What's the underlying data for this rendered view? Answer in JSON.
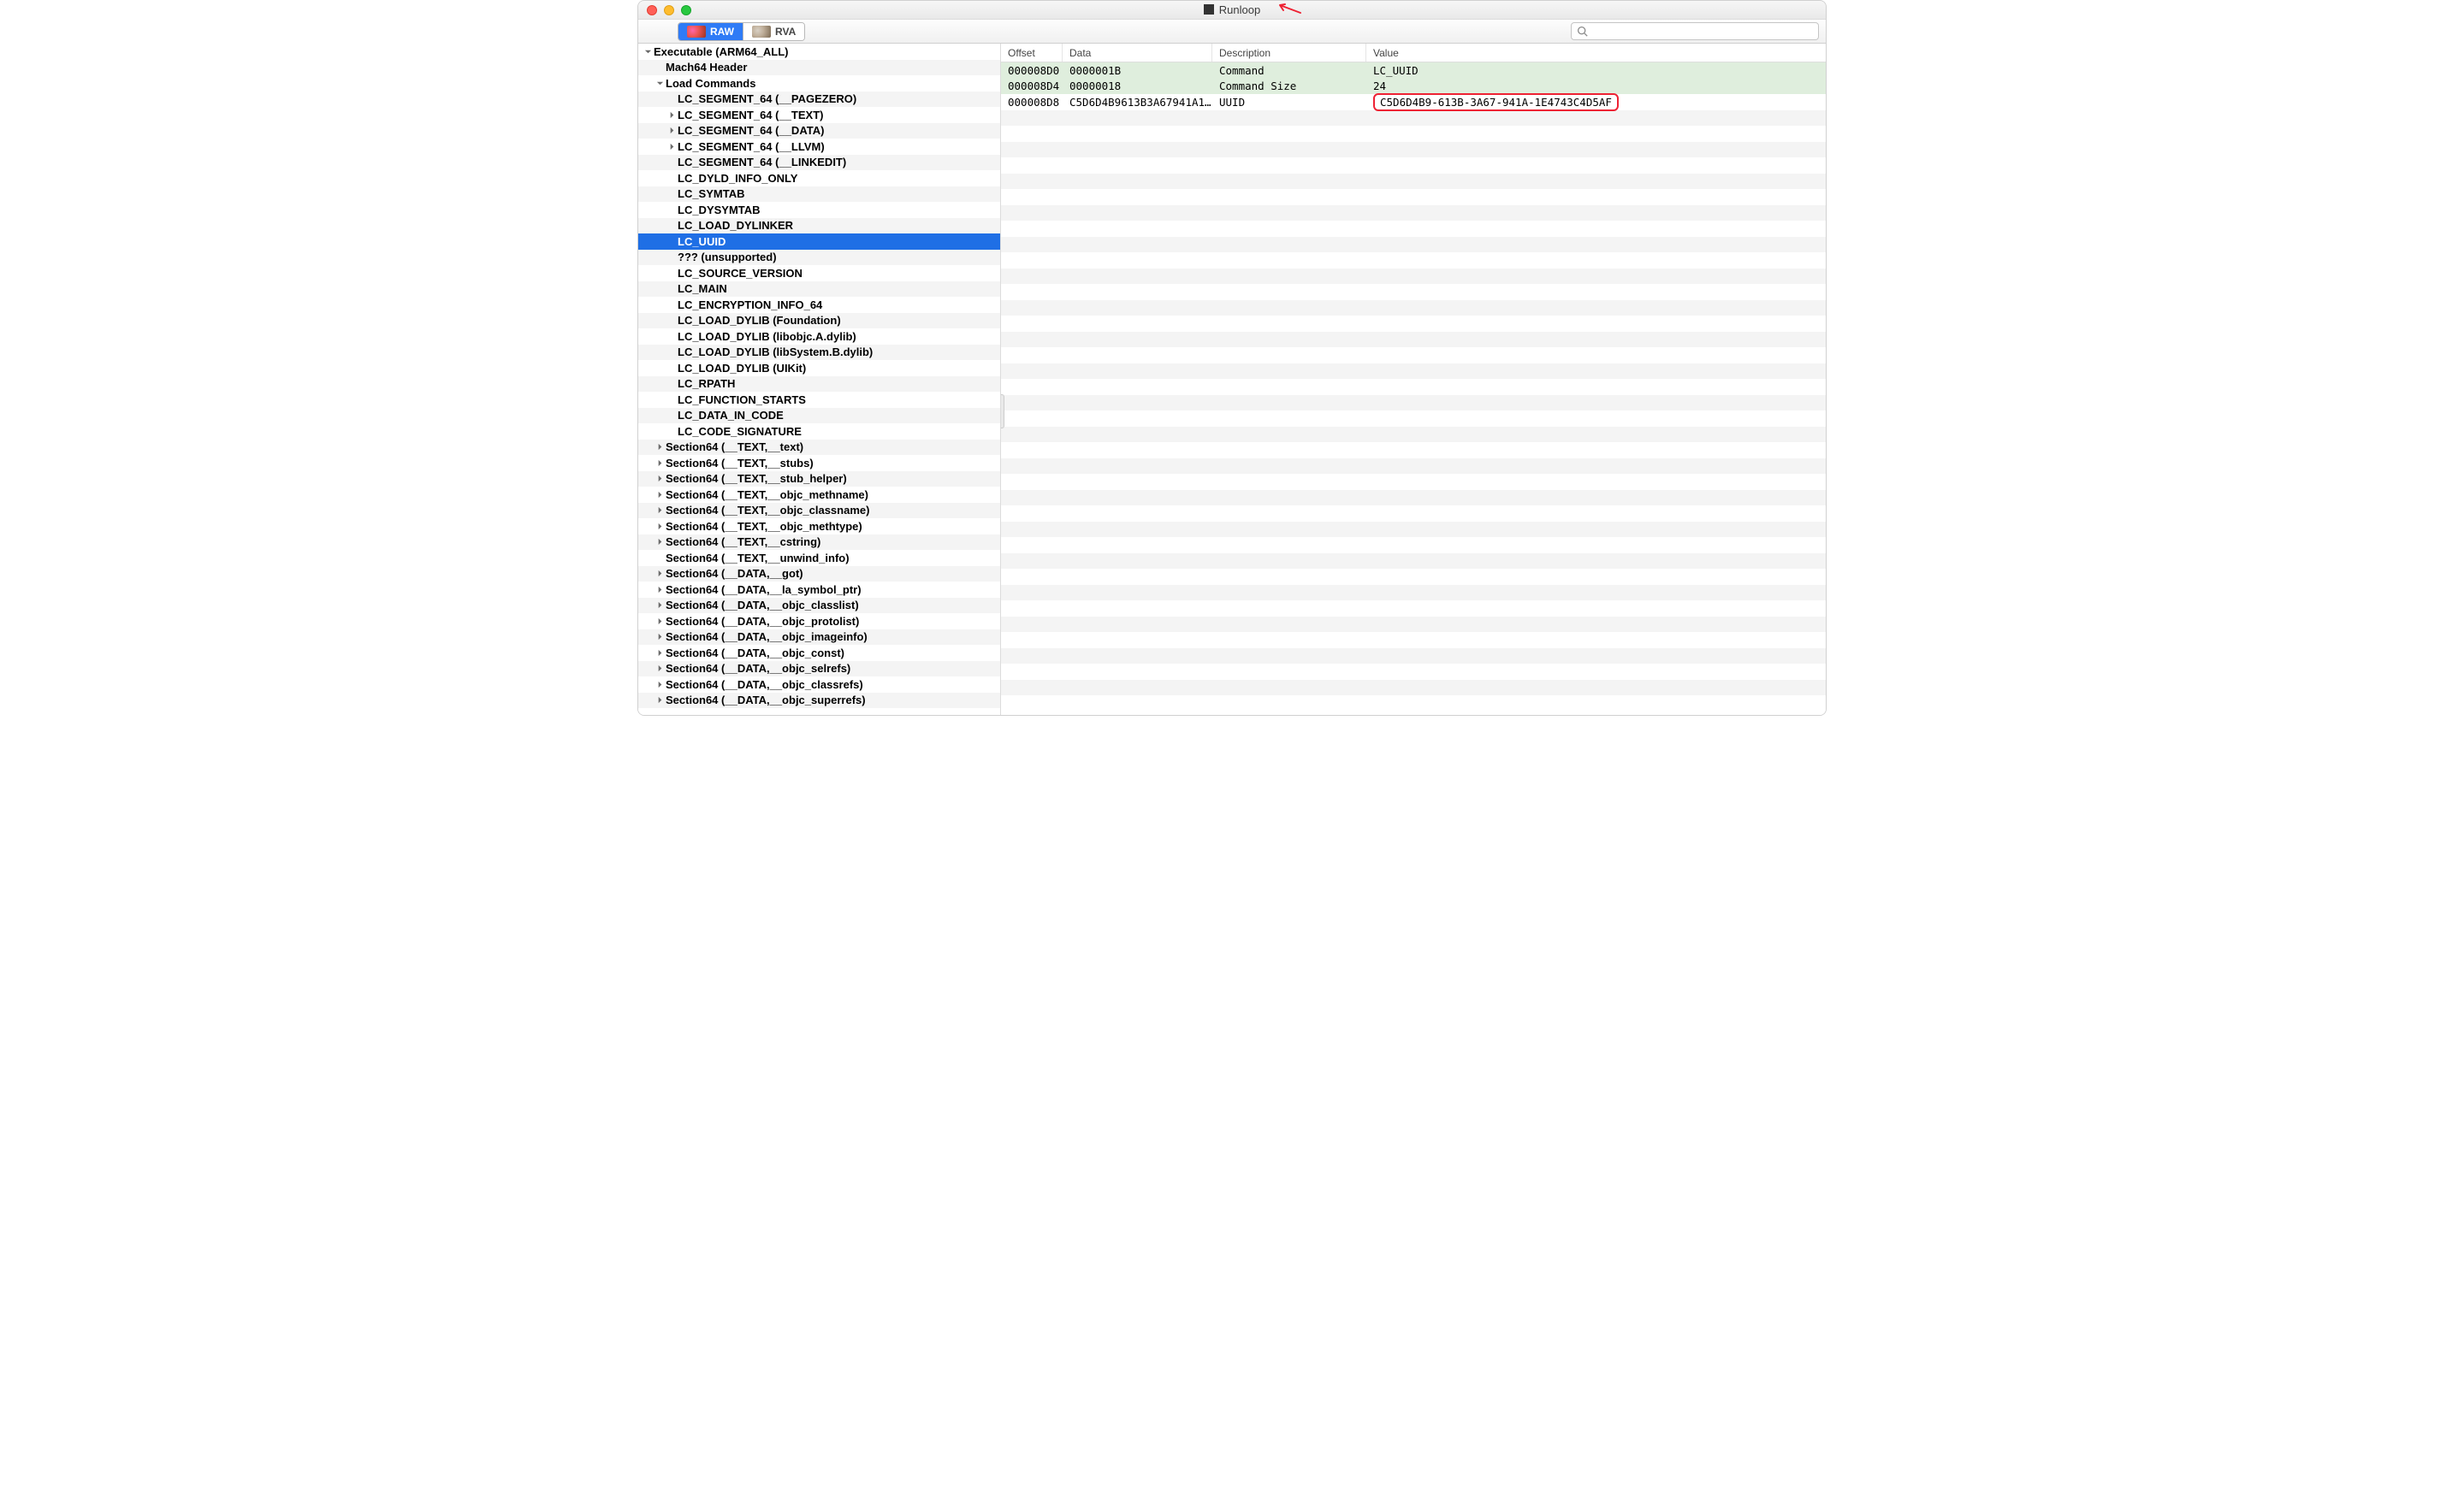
{
  "window": {
    "title": "Runloop"
  },
  "toolbar": {
    "seg_raw": "RAW",
    "seg_rva": "RVA",
    "search_placeholder": ""
  },
  "columns": {
    "offset": "Offset",
    "data": "Data",
    "description": "Description",
    "value": "Value"
  },
  "table": {
    "rows": [
      {
        "offset": "000008D0",
        "data": "0000001B",
        "desc": "Command",
        "value": "LC_UUID",
        "hl": true
      },
      {
        "offset": "000008D4",
        "data": "00000018",
        "desc": "Command Size",
        "value": "24",
        "hl": true
      },
      {
        "offset": "000008D8",
        "data": "C5D6D4B9613B3A67941A1E4…",
        "desc": "UUID",
        "value": "C5D6D4B9-613B-3A67-941A-1E4743C4D5AF",
        "hl": false,
        "value_boxed": true
      }
    ]
  },
  "tree": [
    {
      "depth": 0,
      "arrow": "down",
      "label": "Executable (ARM64_ALL)"
    },
    {
      "depth": 1,
      "arrow": "",
      "label": "Mach64 Header"
    },
    {
      "depth": 1,
      "arrow": "down",
      "label": "Load Commands"
    },
    {
      "depth": 2,
      "arrow": "",
      "label": "LC_SEGMENT_64 (__PAGEZERO)"
    },
    {
      "depth": 2,
      "arrow": "right",
      "label": "LC_SEGMENT_64 (__TEXT)"
    },
    {
      "depth": 2,
      "arrow": "right",
      "label": "LC_SEGMENT_64 (__DATA)"
    },
    {
      "depth": 2,
      "arrow": "right",
      "label": "LC_SEGMENT_64 (__LLVM)"
    },
    {
      "depth": 2,
      "arrow": "",
      "label": "LC_SEGMENT_64 (__LINKEDIT)"
    },
    {
      "depth": 2,
      "arrow": "",
      "label": "LC_DYLD_INFO_ONLY"
    },
    {
      "depth": 2,
      "arrow": "",
      "label": "LC_SYMTAB"
    },
    {
      "depth": 2,
      "arrow": "",
      "label": "LC_DYSYMTAB"
    },
    {
      "depth": 2,
      "arrow": "",
      "label": "LC_LOAD_DYLINKER"
    },
    {
      "depth": 2,
      "arrow": "",
      "label": "LC_UUID",
      "selected": true
    },
    {
      "depth": 2,
      "arrow": "",
      "label": "??? (unsupported)"
    },
    {
      "depth": 2,
      "arrow": "",
      "label": "LC_SOURCE_VERSION"
    },
    {
      "depth": 2,
      "arrow": "",
      "label": "LC_MAIN"
    },
    {
      "depth": 2,
      "arrow": "",
      "label": "LC_ENCRYPTION_INFO_64"
    },
    {
      "depth": 2,
      "arrow": "",
      "label": "LC_LOAD_DYLIB (Foundation)"
    },
    {
      "depth": 2,
      "arrow": "",
      "label": "LC_LOAD_DYLIB (libobjc.A.dylib)"
    },
    {
      "depth": 2,
      "arrow": "",
      "label": "LC_LOAD_DYLIB (libSystem.B.dylib)"
    },
    {
      "depth": 2,
      "arrow": "",
      "label": "LC_LOAD_DYLIB (UIKit)"
    },
    {
      "depth": 2,
      "arrow": "",
      "label": "LC_RPATH"
    },
    {
      "depth": 2,
      "arrow": "",
      "label": "LC_FUNCTION_STARTS"
    },
    {
      "depth": 2,
      "arrow": "",
      "label": "LC_DATA_IN_CODE"
    },
    {
      "depth": 2,
      "arrow": "",
      "label": "LC_CODE_SIGNATURE"
    },
    {
      "depth": 1,
      "arrow": "right",
      "label": "Section64 (__TEXT,__text)"
    },
    {
      "depth": 1,
      "arrow": "right",
      "label": "Section64 (__TEXT,__stubs)"
    },
    {
      "depth": 1,
      "arrow": "right",
      "label": "Section64 (__TEXT,__stub_helper)"
    },
    {
      "depth": 1,
      "arrow": "right",
      "label": "Section64 (__TEXT,__objc_methname)"
    },
    {
      "depth": 1,
      "arrow": "right",
      "label": "Section64 (__TEXT,__objc_classname)"
    },
    {
      "depth": 1,
      "arrow": "right",
      "label": "Section64 (__TEXT,__objc_methtype)"
    },
    {
      "depth": 1,
      "arrow": "right",
      "label": "Section64 (__TEXT,__cstring)"
    },
    {
      "depth": 1,
      "arrow": "",
      "label": "Section64 (__TEXT,__unwind_info)"
    },
    {
      "depth": 1,
      "arrow": "right",
      "label": "Section64 (__DATA,__got)"
    },
    {
      "depth": 1,
      "arrow": "right",
      "label": "Section64 (__DATA,__la_symbol_ptr)"
    },
    {
      "depth": 1,
      "arrow": "right",
      "label": "Section64 (__DATA,__objc_classlist)"
    },
    {
      "depth": 1,
      "arrow": "right",
      "label": "Section64 (__DATA,__objc_protolist)"
    },
    {
      "depth": 1,
      "arrow": "right",
      "label": "Section64 (__DATA,__objc_imageinfo)"
    },
    {
      "depth": 1,
      "arrow": "right",
      "label": "Section64 (__DATA,__objc_const)"
    },
    {
      "depth": 1,
      "arrow": "right",
      "label": "Section64 (__DATA,__objc_selrefs)"
    },
    {
      "depth": 1,
      "arrow": "right",
      "label": "Section64 (__DATA,__objc_classrefs)"
    },
    {
      "depth": 1,
      "arrow": "right",
      "label": "Section64 (__DATA,__objc_superrefs)"
    }
  ]
}
